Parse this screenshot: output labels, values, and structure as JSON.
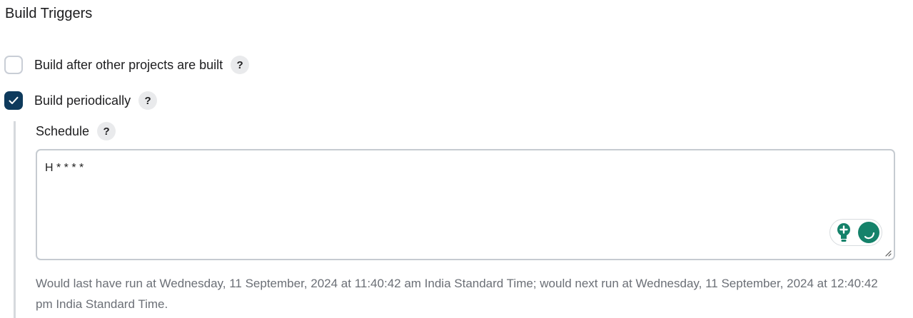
{
  "section": {
    "title": "Build Triggers"
  },
  "triggers": [
    {
      "label": "Build after other projects are built",
      "checked": false
    },
    {
      "label": "Build periodically",
      "checked": true
    }
  ],
  "help_icon_text": "?",
  "schedule": {
    "label": "Schedule",
    "value": "H * * * *",
    "description": "Would last have run at Wednesday, 11 September, 2024 at 11:40:42 am India Standard Time; would next run at Wednesday, 11 September, 2024 at 12:40:42 pm India Standard Time."
  },
  "icons": {
    "checkmark": "check-icon",
    "extension_bulb": "lightbulb-icon",
    "extension_logo": "grammarly-icon",
    "resize": "resize-grip-icon"
  },
  "colors": {
    "checked_bg": "#0e3a5c",
    "extension_green": "#15826a"
  }
}
